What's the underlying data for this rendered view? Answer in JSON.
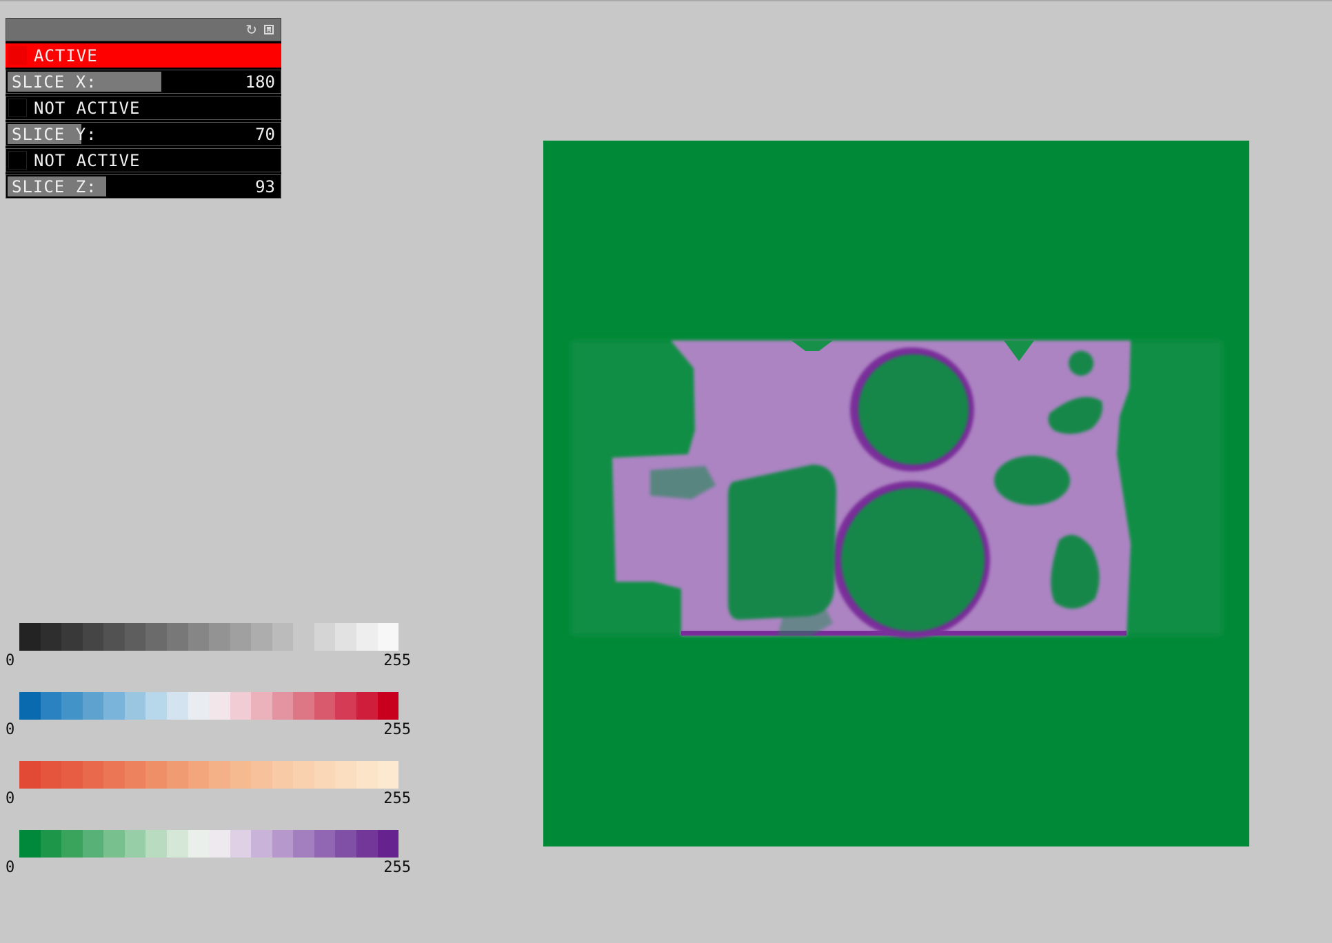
{
  "panel": {
    "header_icons": [
      "refresh-icon",
      "save-icon"
    ],
    "rows": [
      {
        "kind": "toggle",
        "label": "ACTIVE",
        "active": true
      },
      {
        "kind": "slider",
        "label": "SLICE X:",
        "value": "180",
        "fraction": 0.56
      },
      {
        "kind": "toggle",
        "label": "NOT ACTIVE",
        "active": false
      },
      {
        "kind": "slider",
        "label": "SLICE Y:",
        "value": "70",
        "fraction": 0.27
      },
      {
        "kind": "toggle",
        "label": "NOT ACTIVE",
        "active": false
      },
      {
        "kind": "slider",
        "label": "SLICE Z:",
        "value": "93",
        "fraction": 0.36
      }
    ],
    "colors": {
      "active": "#ff0000",
      "inactive": "#000000",
      "header": "#6f6f6f",
      "slider_fill": "#7a7a7a"
    }
  },
  "colorbars": [
    {
      "name": "gray",
      "min": "0",
      "max": "255",
      "colors": [
        "#232323",
        "#2e2e2e",
        "#393939",
        "#454545",
        "#525252",
        "#5e5e5e",
        "#6b6b6b",
        "#787878",
        "#868686",
        "#939393",
        "#a0a0a0",
        "#adadad",
        "#bbbbbb",
        "#c8c8c8",
        "#d5d5d5",
        "#e2e2e2",
        "#eeeeee",
        "#f7f7f7"
      ]
    },
    {
      "name": "blue-red",
      "min": "0",
      "max": "255",
      "colors": [
        "#0a6ab0",
        "#2a82c0",
        "#4293c8",
        "#5ea3d0",
        "#7ab4da",
        "#9bc6e2",
        "#b7d7ea",
        "#d3e3f0",
        "#e9edf2",
        "#f3e6ea",
        "#f1ccd4",
        "#ebb2bc",
        "#e494a1",
        "#dd7786",
        "#d9596d",
        "#d63b55",
        "#cf1e3c",
        "#c8001e"
      ]
    },
    {
      "name": "orange",
      "min": "0",
      "max": "255",
      "colors": [
        "#e34a35",
        "#e5543c",
        "#e65d43",
        "#e9694c",
        "#eb7655",
        "#ed835e",
        "#ef8f68",
        "#f19b72",
        "#f3a67c",
        "#f4b087",
        "#f6ba91",
        "#f7c29b",
        "#f8caa5",
        "#f9d1ae",
        "#fad8b7",
        "#fbdebf",
        "#fce4c8",
        "#fde9cf"
      ]
    },
    {
      "name": "green-purple",
      "min": "0",
      "max": "255",
      "colors": [
        "#00893a",
        "#1e964a",
        "#3aa45d",
        "#58b176",
        "#78c08e",
        "#98cea7",
        "#b9dcc0",
        "#d5e8d8",
        "#ebefec",
        "#eee8ef",
        "#dfd0e5",
        "#cab3d9",
        "#b698cc",
        "#a37fbf",
        "#9166b2",
        "#8050a6",
        "#73379a",
        "#66228e"
      ]
    }
  ],
  "viewport": {
    "background": "#008936",
    "material_color": "#ac84c2",
    "edge_color": "#7a2d9a",
    "hole_color": "#16874a"
  }
}
